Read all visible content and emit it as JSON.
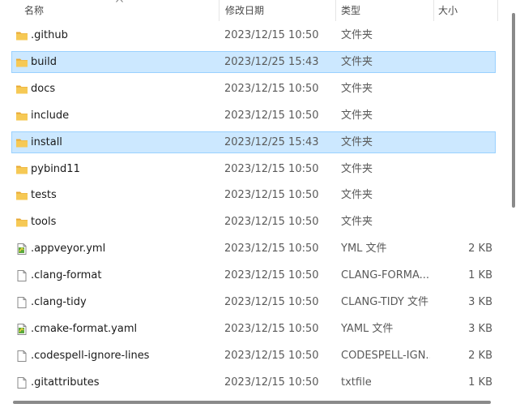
{
  "columns": {
    "name": "名称",
    "date": "修改日期",
    "type": "类型",
    "size": "大小"
  },
  "colors": {
    "selected_bg": "#cce8ff",
    "selected_border": "#99d1ff",
    "folder": "#f4c35a"
  },
  "files": [
    {
      "name": ".github",
      "date": "2023/12/15 10:50",
      "type": "文件夹",
      "size": "",
      "icon": "folder-icon",
      "selected": false
    },
    {
      "name": "build",
      "date": "2023/12/25 15:43",
      "type": "文件夹",
      "size": "",
      "icon": "folder-icon",
      "selected": true
    },
    {
      "name": "docs",
      "date": "2023/12/15 10:50",
      "type": "文件夹",
      "size": "",
      "icon": "folder-icon",
      "selected": false
    },
    {
      "name": "include",
      "date": "2023/12/15 10:50",
      "type": "文件夹",
      "size": "",
      "icon": "folder-icon",
      "selected": false
    },
    {
      "name": "install",
      "date": "2023/12/25 15:43",
      "type": "文件夹",
      "size": "",
      "icon": "folder-icon",
      "selected": true
    },
    {
      "name": "pybind11",
      "date": "2023/12/15 10:50",
      "type": "文件夹",
      "size": "",
      "icon": "folder-icon",
      "selected": false
    },
    {
      "name": "tests",
      "date": "2023/12/15 10:50",
      "type": "文件夹",
      "size": "",
      "icon": "folder-icon",
      "selected": false
    },
    {
      "name": "tools",
      "date": "2023/12/15 10:50",
      "type": "文件夹",
      "size": "",
      "icon": "folder-icon",
      "selected": false
    },
    {
      "name": ".appveyor.yml",
      "date": "2023/12/15 10:50",
      "type": "YML 文件",
      "size": "2 KB",
      "icon": "yaml-file-icon",
      "selected": false
    },
    {
      "name": ".clang-format",
      "date": "2023/12/15 10:50",
      "type": "CLANG-FORMA...",
      "size": "1 KB",
      "icon": "file-icon",
      "selected": false
    },
    {
      "name": ".clang-tidy",
      "date": "2023/12/15 10:50",
      "type": "CLANG-TIDY 文件",
      "size": "3 KB",
      "icon": "file-icon",
      "selected": false
    },
    {
      "name": ".cmake-format.yaml",
      "date": "2023/12/15 10:50",
      "type": "YAML 文件",
      "size": "3 KB",
      "icon": "yaml-file-icon",
      "selected": false
    },
    {
      "name": ".codespell-ignore-lines",
      "date": "2023/12/15 10:50",
      "type": "CODESPELL-IGN...",
      "size": "2 KB",
      "icon": "file-icon",
      "selected": false
    },
    {
      "name": ".gitattributes",
      "date": "2023/12/15 10:50",
      "type": "txtfile",
      "size": "1 KB",
      "icon": "file-icon",
      "selected": false
    }
  ]
}
